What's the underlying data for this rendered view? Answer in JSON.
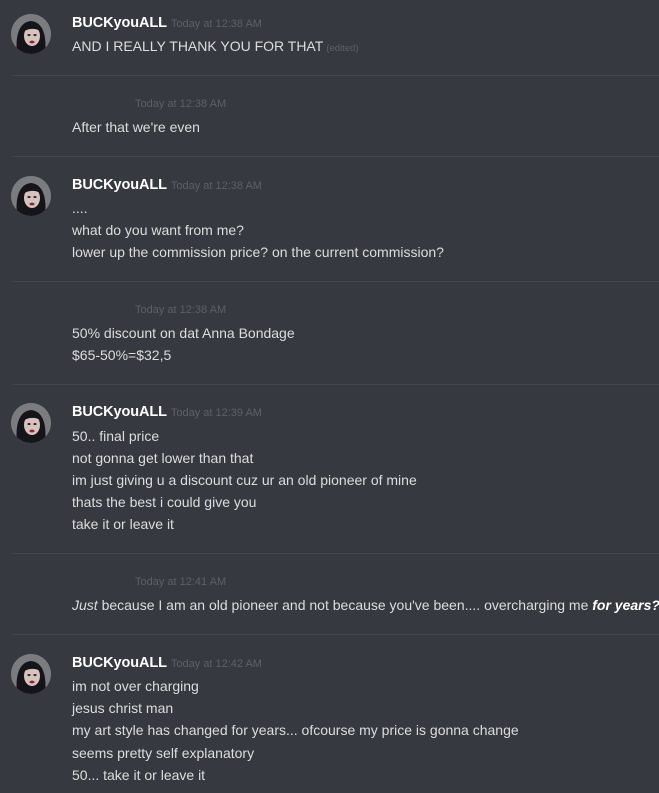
{
  "user": {
    "name": "BUCKyouALL",
    "avatar_icon": "user-avatar-icon"
  },
  "messages": [
    {
      "author": "BUCKyouALL",
      "timestamp": "Today at 12:38 AM",
      "lines": [
        "AND I REALLY THANK YOU FOR THAT"
      ],
      "edited": "(edited)"
    },
    {
      "timestamp": "Today at 12:38 AM",
      "lines": [
        "After that we're even"
      ]
    },
    {
      "author": "BUCKyouALL",
      "timestamp": "Today at 12:38 AM",
      "lines": [
        "....",
        "what do you want from me?",
        "lower up the commission price? on the current commission?"
      ]
    },
    {
      "timestamp": "Today at 12:38 AM",
      "lines": [
        "50% discount on dat Anna Bondage",
        "$65-50%=$32,5"
      ]
    },
    {
      "author": "BUCKyouALL",
      "timestamp": "Today at 12:39 AM",
      "lines": [
        "50.. final price",
        "not gonna get lower than that",
        "im just giving u a discount cuz ur an old pioneer of mine",
        "thats the best i could give you",
        "take it or leave it"
      ]
    },
    {
      "timestamp": "Today at 12:41 AM",
      "rich_line": {
        "italic": "Just",
        "middle": " because I am an old pioneer and not because you've been.... overcharging me ",
        "bold_italic": "for years?"
      }
    },
    {
      "author": "BUCKyouALL",
      "timestamp": "Today at 12:42 AM",
      "lines": [
        "im not over charging",
        "jesus christ man",
        "my art style has changed for years... ofcourse my price is gonna change",
        "seems pretty self explanatory",
        "50... take it or leave it"
      ]
    }
  ]
}
